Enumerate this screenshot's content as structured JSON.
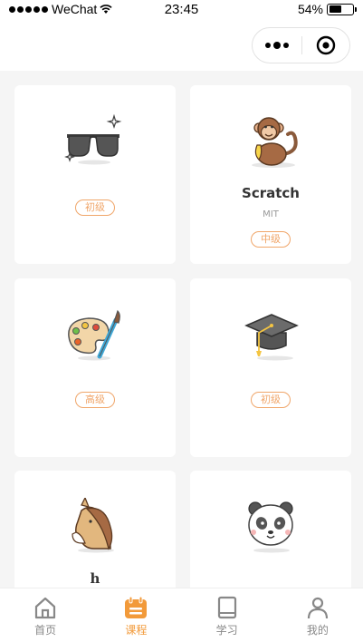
{
  "status_bar": {
    "carrier": "WeChat",
    "time": "23:45",
    "battery": "54%",
    "battery_level": 0.54
  },
  "capsule": {
    "more_icon": "more-dots-icon",
    "close_icon": "target-circle-icon"
  },
  "courses": [
    {
      "icon": "sunglasses-icon",
      "title": "",
      "subtitle": "",
      "level": "初级"
    },
    {
      "icon": "monkey-icon",
      "title": "Scratch",
      "subtitle": "MIT",
      "level": "中级"
    },
    {
      "icon": "paint-palette-icon",
      "title": "",
      "subtitle": "",
      "level": "高级"
    },
    {
      "icon": "graduation-cap-icon",
      "title": "",
      "subtitle": "",
      "level": "初级"
    },
    {
      "icon": "horse-icon",
      "title": "h",
      "subtitle": "",
      "level": ""
    },
    {
      "icon": "panda-icon",
      "title": "",
      "subtitle": "",
      "level": ""
    }
  ],
  "tabs": [
    {
      "label": "首页",
      "icon": "home-icon",
      "active": false
    },
    {
      "label": "课程",
      "icon": "calendar-icon",
      "active": true
    },
    {
      "label": "学习",
      "icon": "book-icon",
      "active": false
    },
    {
      "label": "我的",
      "icon": "user-icon",
      "active": false
    }
  ],
  "colors": {
    "accent": "#f29a3a",
    "badge": "#f0a66a",
    "background": "#f5f5f5"
  }
}
